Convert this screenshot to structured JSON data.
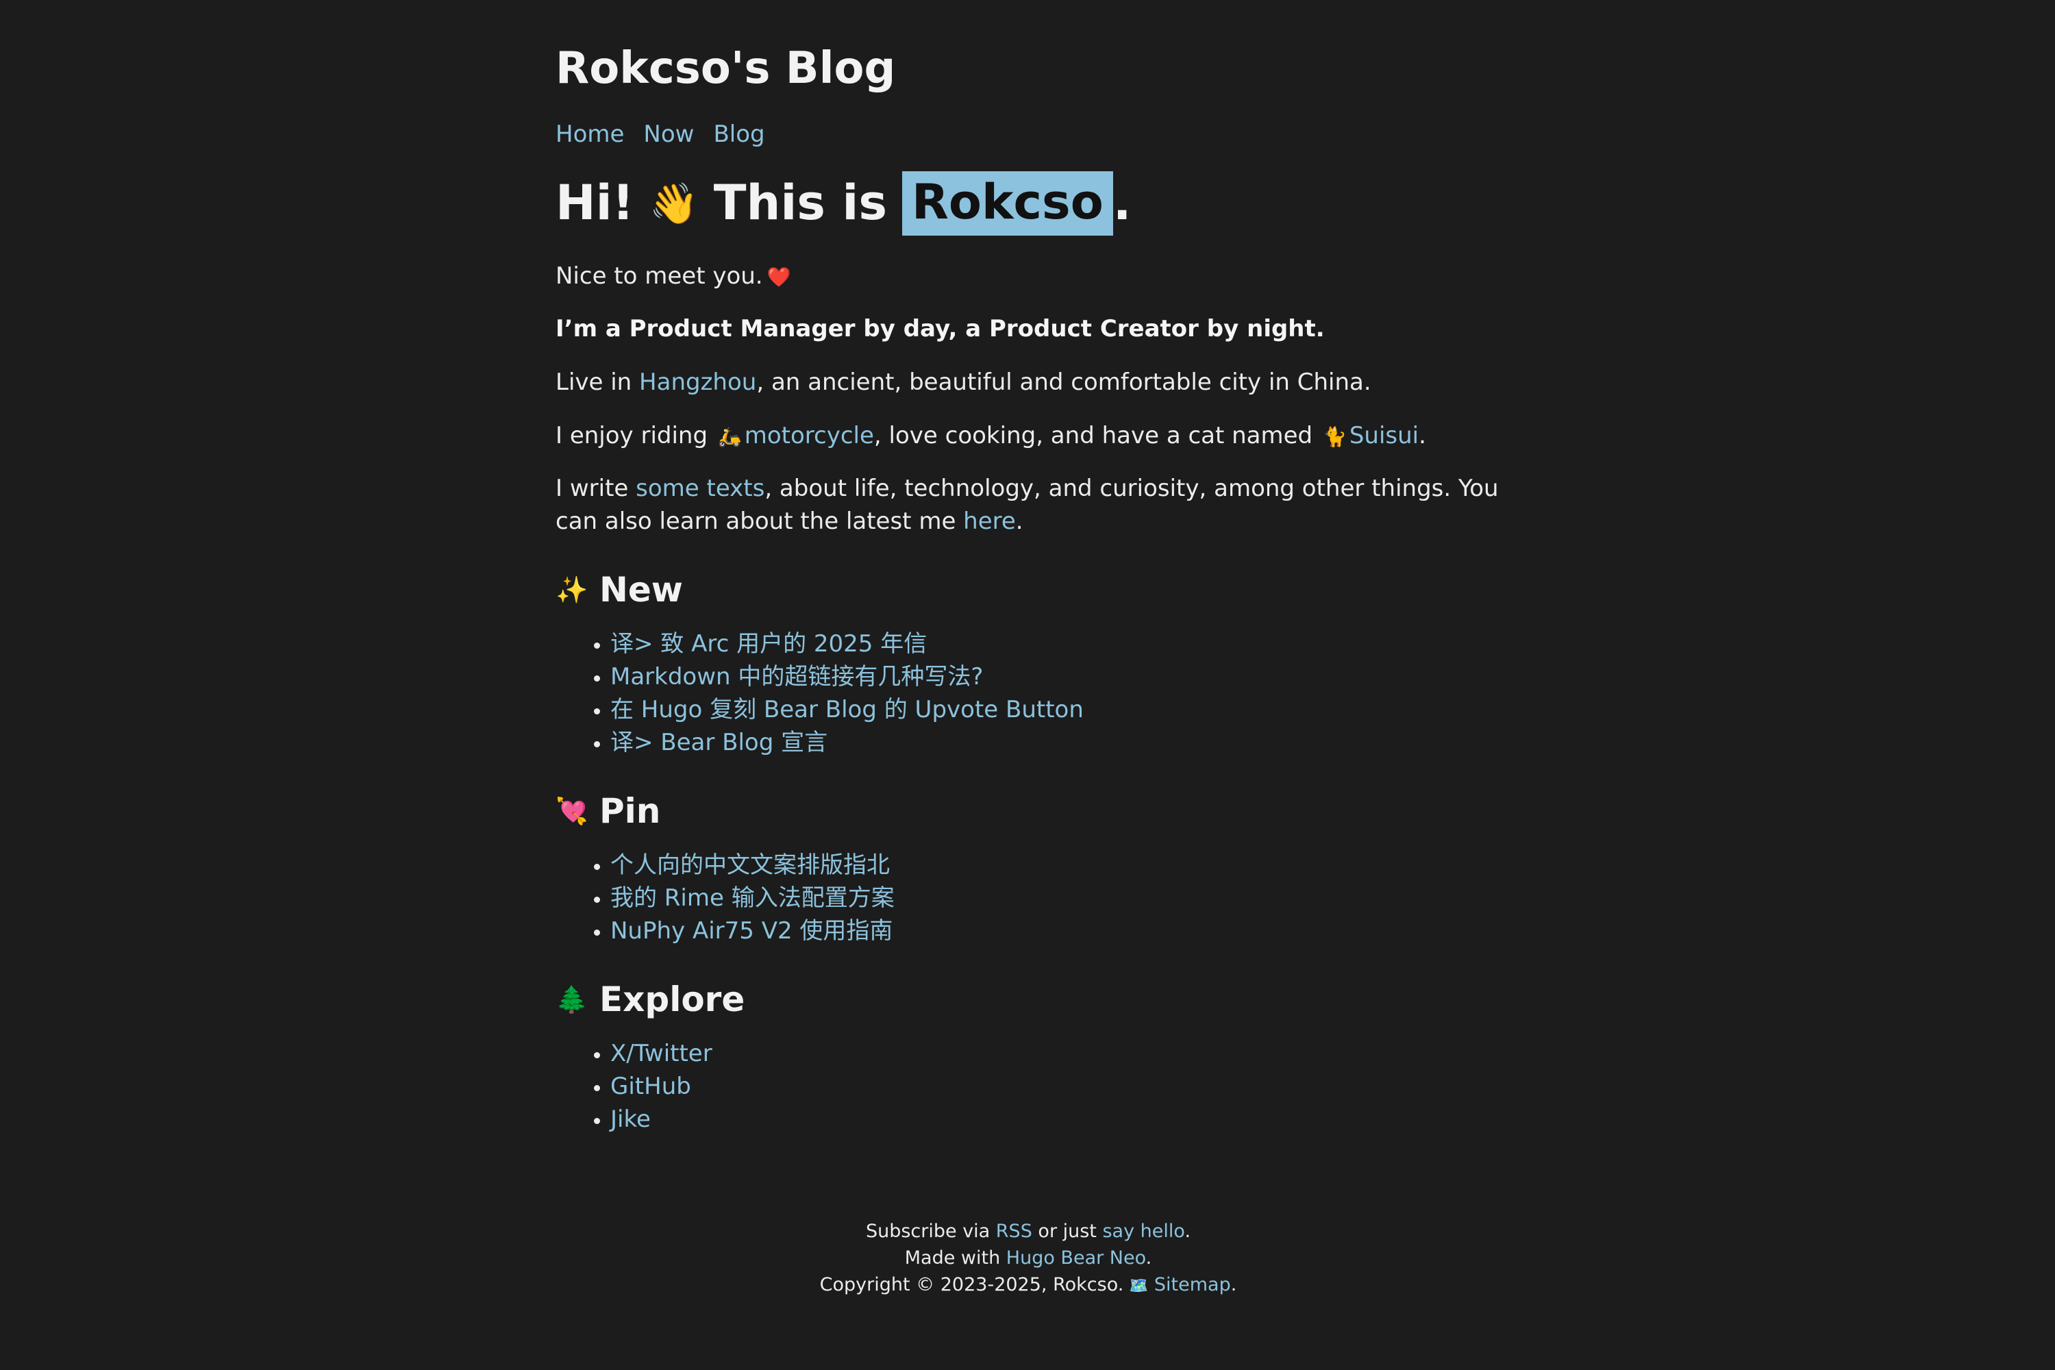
{
  "site": {
    "title": "Rokcso's Blog",
    "nav": [
      "Home",
      "Now",
      "Blog"
    ]
  },
  "hero": {
    "prefix": "Hi!",
    "wave_emoji": "👋",
    "middle": "This is",
    "name": "Rokcso",
    "suffix": "."
  },
  "intro": {
    "p1_text": "Nice to meet you.",
    "p1_emoji": "❤️",
    "tagline": "I’m a Product Manager by day, a Product Creator by night.",
    "p3_pre": "Live in ",
    "p3_link": "Hangzhou",
    "p3_post": ", an ancient, beautiful and comfortable city in China.",
    "p4_pre": "I enjoy riding ",
    "p4_emoji1": "🛵",
    "p4_link1": "motorcycle",
    "p4_mid": ", love cooking, and have a cat named ",
    "p4_emoji2": "🐈",
    "p4_link2": "Suisui",
    "p4_post": ".",
    "p5_pre": "I write ",
    "p5_link1": "some texts",
    "p5_mid": ", about life, technology, and curiosity, among other things. You can also learn about the latest me ",
    "p5_link2": "here",
    "p5_post": "."
  },
  "sections": {
    "new": {
      "icon": "✨",
      "title": "New",
      "items": [
        "译> 致 Arc 用户的 2025 年信",
        "Markdown 中的超链接有几种写法?",
        "在 Hugo 复刻 Bear Blog 的 Upvote Button",
        "译> Bear Blog 宣言"
      ]
    },
    "pin": {
      "icon": "💘",
      "title": "Pin",
      "items": [
        "个人向的中文文案排版指北",
        "我的 Rime 输入法配置方案",
        "NuPhy Air75 V2 使用指南"
      ]
    },
    "explore": {
      "icon": "🌲",
      "title": "Explore",
      "items": [
        "X/Twitter",
        "GitHub",
        "Jike"
      ]
    }
  },
  "footer": {
    "l1_pre": "Subscribe via ",
    "l1_link1": "RSS",
    "l1_mid": " or just ",
    "l1_link2": "say hello",
    "l1_post": ".",
    "l2_pre": "Made with ",
    "l2_link": "Hugo Bear Neo",
    "l2_post": ".",
    "l3_pre": "Copyright © 2023-2025, Rokcso. ",
    "l3_emoji": "🗺️",
    "l3_link": "Sitemap",
    "l3_post": "."
  },
  "colors": {
    "background": "#1c1c1c",
    "text": "#ececec",
    "link": "#8cc2dd",
    "highlight": "#8cc2dd"
  }
}
